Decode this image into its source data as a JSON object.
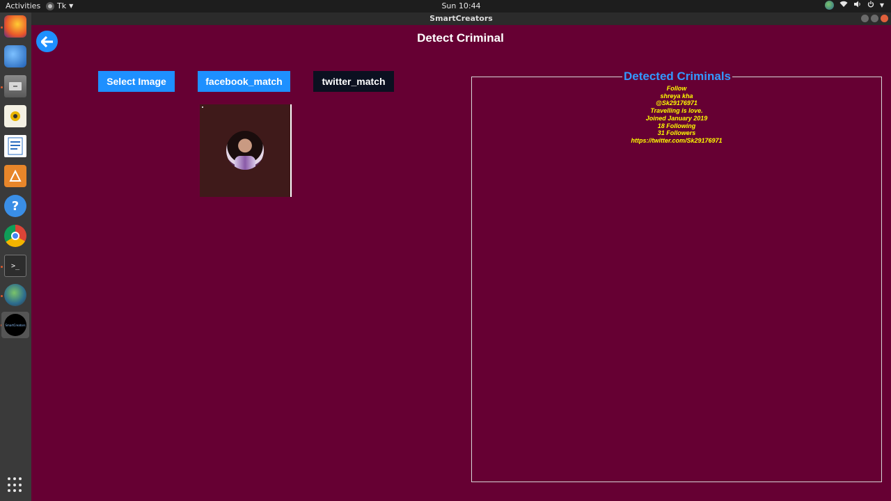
{
  "topbar": {
    "activities": "Activities",
    "app_menu": "Tk",
    "clock": "Sun 10:44"
  },
  "window": {
    "title": "SmartCreators"
  },
  "dock": {
    "items": [
      "firefox-icon",
      "thunderbird-icon",
      "files-icon",
      "rhythmbox-icon",
      "libreoffice-writer-icon",
      "software-center-icon",
      "help-icon",
      "chrome-icon",
      "terminal-icon",
      "globe-app-icon",
      "smartcreators-icon"
    ],
    "smartcreators_label": "SmartCreators"
  },
  "app": {
    "title": "Detect Criminal",
    "buttons": {
      "select_image": "Select Image",
      "facebook_match": "facebook_match",
      "twitter_match": "twitter_match"
    },
    "results": {
      "heading": "Detected Criminals",
      "lines": [
        "Follow",
        "shreya kha",
        "@Sk29176971",
        "Travelling is love.",
        "Joined January 2019",
        "18 Following",
        "31 Followers",
        "https://twitter.com/Sk29176971"
      ]
    }
  }
}
